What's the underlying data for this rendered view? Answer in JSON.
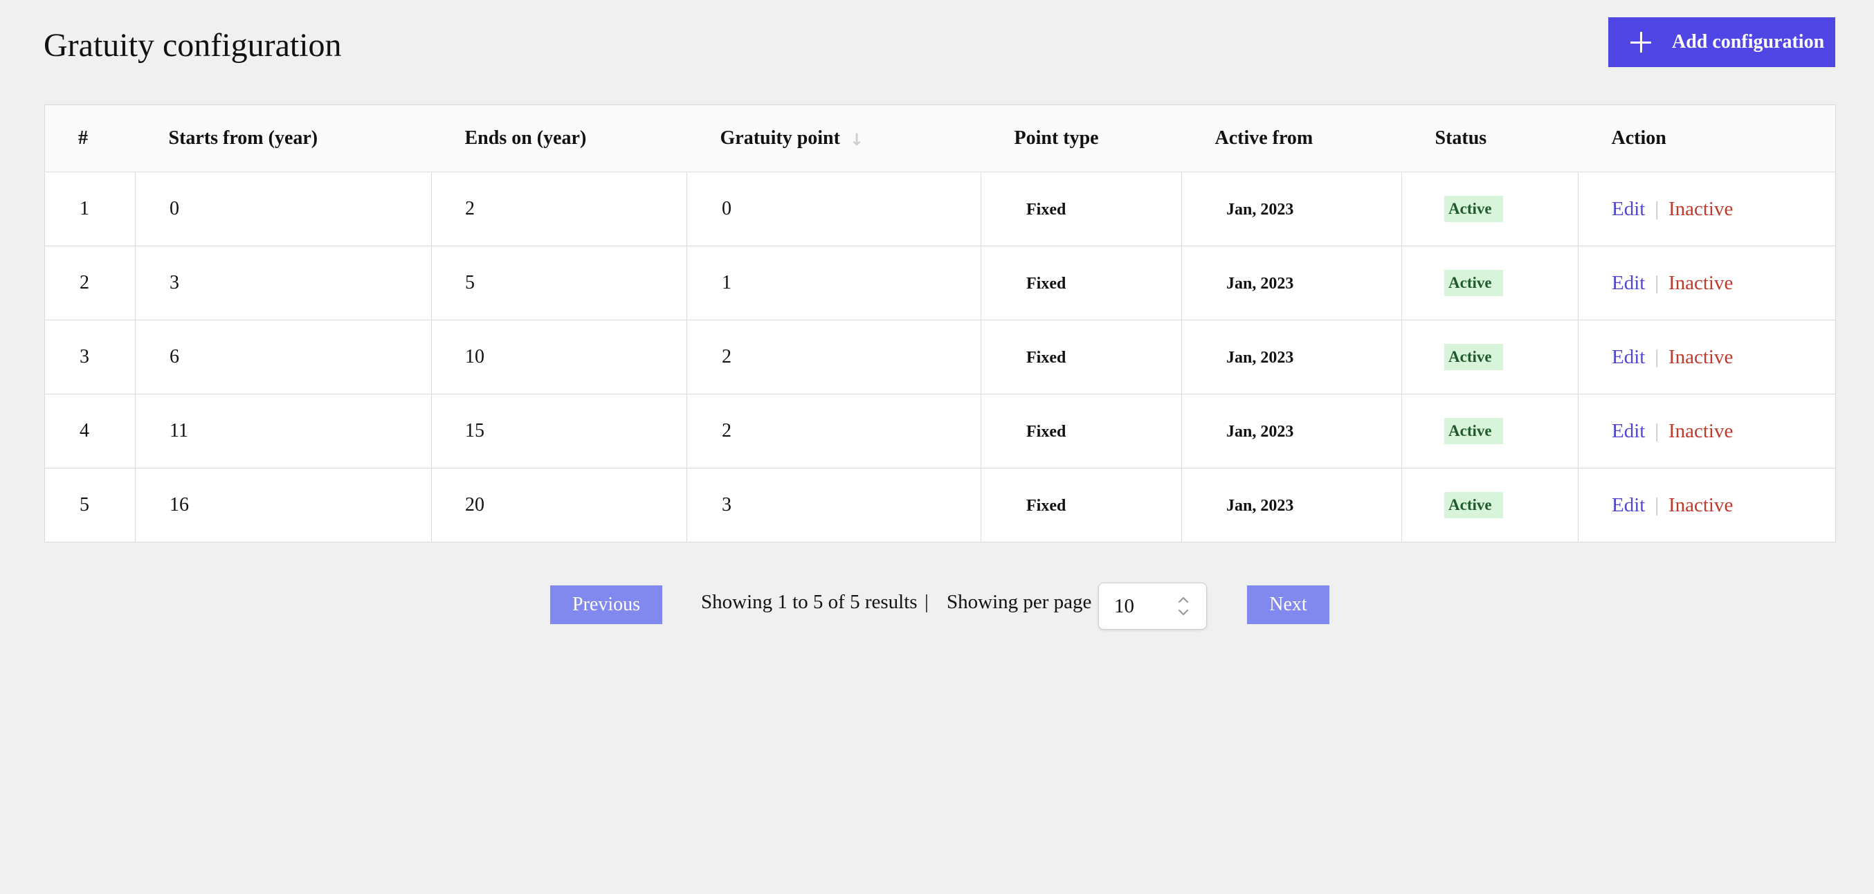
{
  "page": {
    "title": "Gratuity configuration",
    "add_button_label": "Add configuration"
  },
  "colors": {
    "primary": "#4f46e5",
    "pagination_button": "#8189ef",
    "edit_link": "#5046d2",
    "inactive_link": "#c0392b",
    "badge_bg": "#d8f5dc",
    "badge_text": "#1f5a2b"
  },
  "table": {
    "headers": {
      "index": "#",
      "starts_from": "Starts from (year)",
      "ends_on": "Ends on (year)",
      "gratuity_point": "Gratuity point",
      "point_type": "Point type",
      "active_from": "Active from",
      "status": "Status",
      "action": "Action"
    },
    "sort_icon": "arrow-down-icon",
    "rows": [
      {
        "index": "1",
        "starts_from": "0",
        "ends_on": "2",
        "gratuity_point": "0",
        "point_type": "Fixed",
        "active_from": "Jan, 2023",
        "status": "Active",
        "edit": "Edit",
        "separator": "|",
        "inactive": "Inactive"
      },
      {
        "index": "2",
        "starts_from": "3",
        "ends_on": "5",
        "gratuity_point": "1",
        "point_type": "Fixed",
        "active_from": "Jan, 2023",
        "status": "Active",
        "edit": "Edit",
        "separator": "|",
        "inactive": "Inactive"
      },
      {
        "index": "3",
        "starts_from": "6",
        "ends_on": "10",
        "gratuity_point": "2",
        "point_type": "Fixed",
        "active_from": "Jan, 2023",
        "status": "Active",
        "edit": "Edit",
        "separator": "|",
        "inactive": "Inactive"
      },
      {
        "index": "4",
        "starts_from": "11",
        "ends_on": "15",
        "gratuity_point": "2",
        "point_type": "Fixed",
        "active_from": "Jan, 2023",
        "status": "Active",
        "edit": "Edit",
        "separator": "|",
        "inactive": "Inactive"
      },
      {
        "index": "5",
        "starts_from": "16",
        "ends_on": "20",
        "gratuity_point": "3",
        "point_type": "Fixed",
        "active_from": "Jan, 2023",
        "status": "Active",
        "edit": "Edit",
        "separator": "|",
        "inactive": "Inactive"
      }
    ]
  },
  "pagination": {
    "previous_label": "Previous",
    "next_label": "Next",
    "summary": "Showing 1 to 5 of 5 results",
    "separator": "|",
    "per_page_label": "Showing per page",
    "per_page_value": "10"
  }
}
